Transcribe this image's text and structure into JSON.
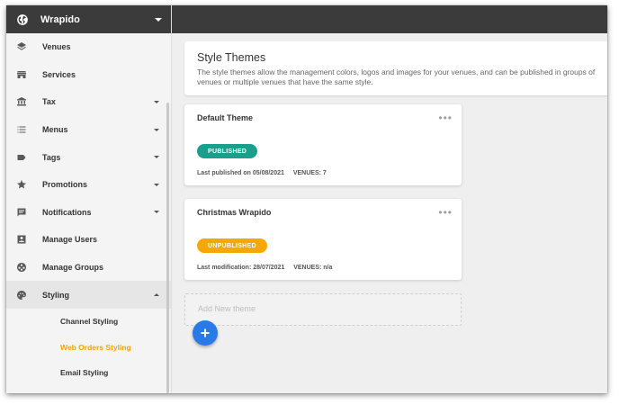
{
  "brand": {
    "name": "Wrapido"
  },
  "sidebar": {
    "items": [
      {
        "label": "Venues",
        "icon": "layers-icon",
        "expandable": false
      },
      {
        "label": "Services",
        "icon": "store-icon",
        "expandable": false
      },
      {
        "label": "Tax",
        "icon": "bank-icon",
        "expandable": true
      },
      {
        "label": "Menus",
        "icon": "list-icon",
        "expandable": true
      },
      {
        "label": "Tags",
        "icon": "tag-icon",
        "expandable": true
      },
      {
        "label": "Promotions",
        "icon": "star-icon",
        "expandable": true
      },
      {
        "label": "Notifications",
        "icon": "message-icon",
        "expandable": true
      },
      {
        "label": "Manage Users",
        "icon": "user-card-icon",
        "expandable": false
      },
      {
        "label": "Manage Groups",
        "icon": "group-icon",
        "expandable": false
      },
      {
        "label": "Styling",
        "icon": "palette-icon",
        "expandable": true,
        "expanded": true
      }
    ],
    "styling_sub": [
      {
        "label": "Channel Styling",
        "selected": false
      },
      {
        "label": "Web Orders Styling",
        "selected": true
      },
      {
        "label": "Email Styling",
        "selected": false
      }
    ]
  },
  "header": {
    "title": "Style Themes",
    "description": "The style themes allow the management colors, logos and images for your venues, and can be published in groups of venues or multiple venues that have the same style."
  },
  "themes": [
    {
      "name": "Default Theme",
      "status": "PUBLISHED",
      "status_color": "#1a9f8c",
      "date_text": "Last published on 05/08/2021",
      "venues_text": "VENUES: 7"
    },
    {
      "name": "Christmas Wrapido",
      "status": "UNPUBLISHED",
      "status_color": "#f5a800",
      "date_text": "Last modification: 28/07/2021",
      "venues_text": "VENUES: n/a"
    }
  ],
  "add_theme": {
    "placeholder": "Add New theme"
  },
  "colors": {
    "accent": "#f0a500",
    "fab": "#2979e6",
    "topbar": "#3b3b3b"
  }
}
